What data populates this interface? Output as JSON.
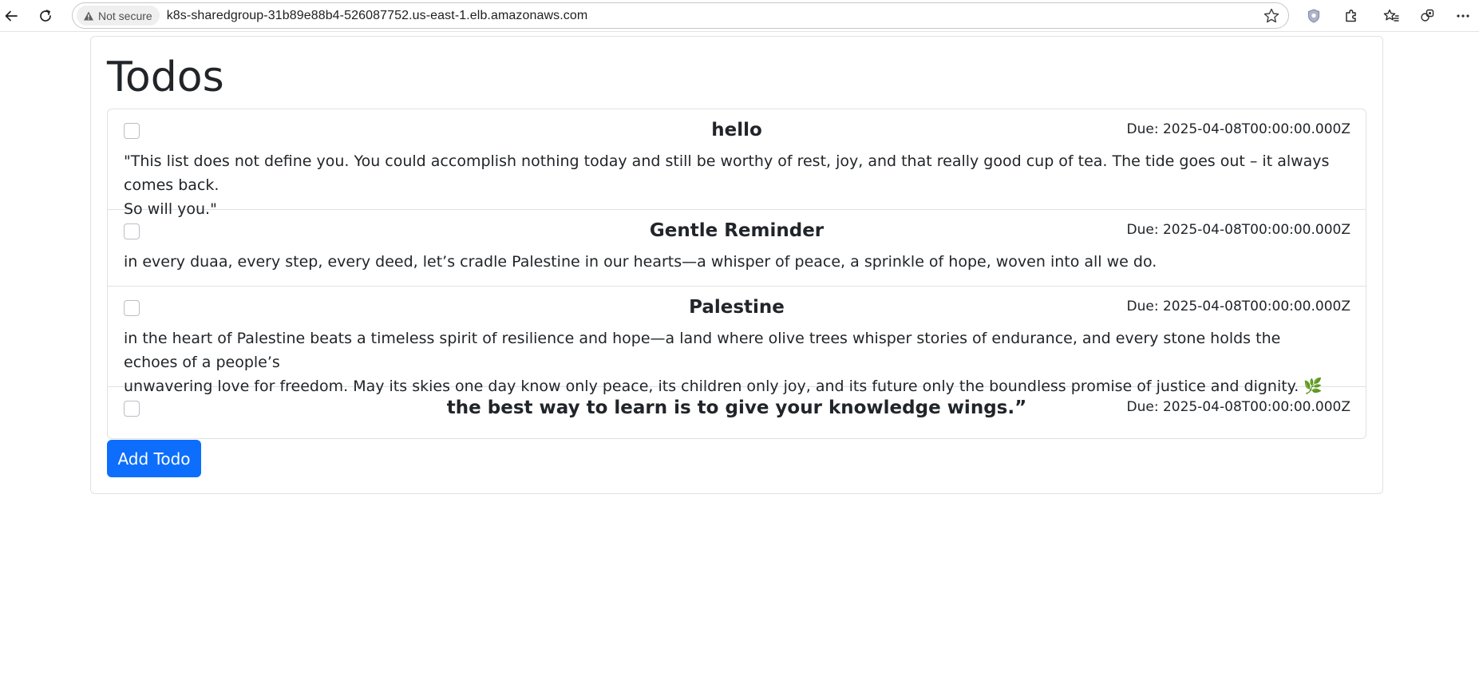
{
  "browser": {
    "security_label": "Not secure",
    "url": "k8s-sharedgroup-31b89e88b4-526087752.us-east-1.elb.amazonaws.com"
  },
  "page": {
    "title": "Todos",
    "add_button_label": "Add Todo"
  },
  "todos": [
    {
      "title": "hello",
      "due": "Due: 2025-04-08T00:00:00.000Z",
      "description_lines": [
        "\"This list does not define you. You could accomplish nothing today and still be worthy of rest, joy, and that really good cup of tea. The tide goes out – it always comes back.",
        "So will you.\""
      ]
    },
    {
      "title": "Gentle Reminder",
      "due": "Due: 2025-04-08T00:00:00.000Z",
      "description_lines": [
        "in every duaa, every step, every deed, let’s cradle Palestine in our hearts—a whisper of peace, a sprinkle of hope, woven into all we do."
      ]
    },
    {
      "title": "Palestine",
      "due": "Due: 2025-04-08T00:00:00.000Z",
      "description_lines": [
        "in the heart of Palestine beats a timeless spirit of resilience and hope—a land where olive trees whisper stories of endurance, and every stone holds the echoes of a people’s",
        "unwavering love for freedom. May its skies one day know only peace, its children only joy, and its future only the boundless promise of justice and dignity. 🌿"
      ]
    },
    {
      "title": "the best way to learn is to give your knowledge wings.”",
      "due": "Due: 2025-04-08T00:00:00.000Z",
      "description_lines": []
    }
  ],
  "colors": {
    "primary_button": "#0d6efd",
    "border": "#dee2e6",
    "text": "#212529"
  },
  "icons": {
    "back": "back-arrow-icon",
    "reload": "reload-icon",
    "warning": "warning-triangle-icon",
    "favorite": "star-icon",
    "shield": "shield-icon",
    "extensions": "puzzle-icon",
    "favorites_list": "favorites-list-icon",
    "profile": "profile-icon",
    "menu": "more-menu-icon"
  }
}
